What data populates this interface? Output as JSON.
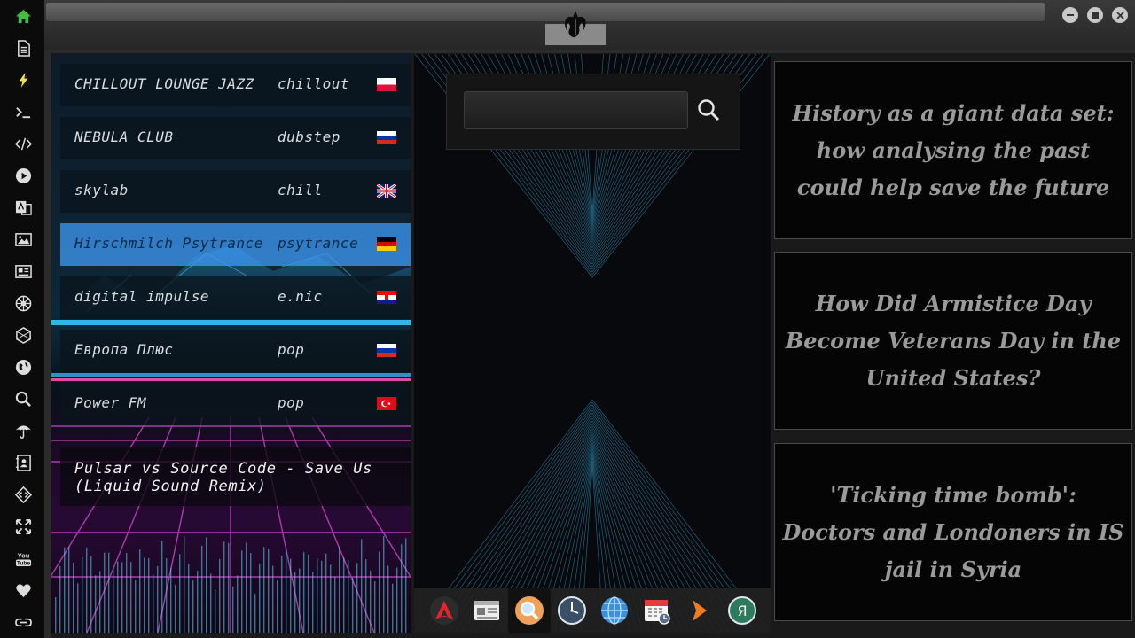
{
  "sidebar": {
    "icons": [
      "home-icon",
      "document-icon",
      "lightning-icon",
      "terminal-icon",
      "code-icon",
      "play-icon",
      "translate-icon",
      "image-icon",
      "news-icon",
      "empire-icon",
      "hexagon-icon",
      "globe-icon",
      "search-icon",
      "umbrella-icon",
      "contacts-icon",
      "diamond-code-icon",
      "expand-icon",
      "youtube-icon",
      "heart-icon",
      "link-icon"
    ],
    "home_color": "#3fbf3f",
    "lightning_color": "#f2e24a"
  },
  "window": {
    "logo": "rebel-alliance-icon",
    "controls": [
      "minimize-icon",
      "maximize-icon",
      "close-icon"
    ]
  },
  "radio": {
    "stations": [
      {
        "name": "CHILLOUT LOUNGE JAZZ",
        "genre": "chillout",
        "flag": "poland",
        "active": false
      },
      {
        "name": "NEBULA CLUB",
        "genre": "dubstep",
        "flag": "russia",
        "active": false
      },
      {
        "name": "skylab",
        "genre": "chill",
        "flag": "uk",
        "active": false
      },
      {
        "name": "Hirschmilch Psytrance",
        "genre": "psytrance",
        "flag": "germany",
        "active": true
      },
      {
        "name": "digital impulse",
        "genre": "e.nic",
        "flag": "croatia",
        "active": false
      },
      {
        "name": "Европа Плюс",
        "genre": "pop",
        "flag": "russia",
        "active": false
      },
      {
        "name": "Power FM",
        "genre": "pop",
        "flag": "turkey",
        "active": false
      }
    ],
    "now_playing": "Pulsar vs Source Code - Save Us (Liquid Sound Remix)"
  },
  "search": {
    "value": "",
    "placeholder": ""
  },
  "dock": {
    "items": [
      "arch-icon",
      "newspaper-icon",
      "search-app-icon",
      "clock-icon",
      "globe-app-icon",
      "calendar-icon",
      "arrow-icon",
      "yandex-icon"
    ],
    "active_index": 2
  },
  "news": [
    {
      "title": "History as a giant data set: how analysing the past could help save the future"
    },
    {
      "title": "How Did Armistice Day Become Veterans Day in the United States?"
    },
    {
      "title": "'Ticking time bomb': Doctors and Londoners in IS jail in Syria"
    }
  ]
}
